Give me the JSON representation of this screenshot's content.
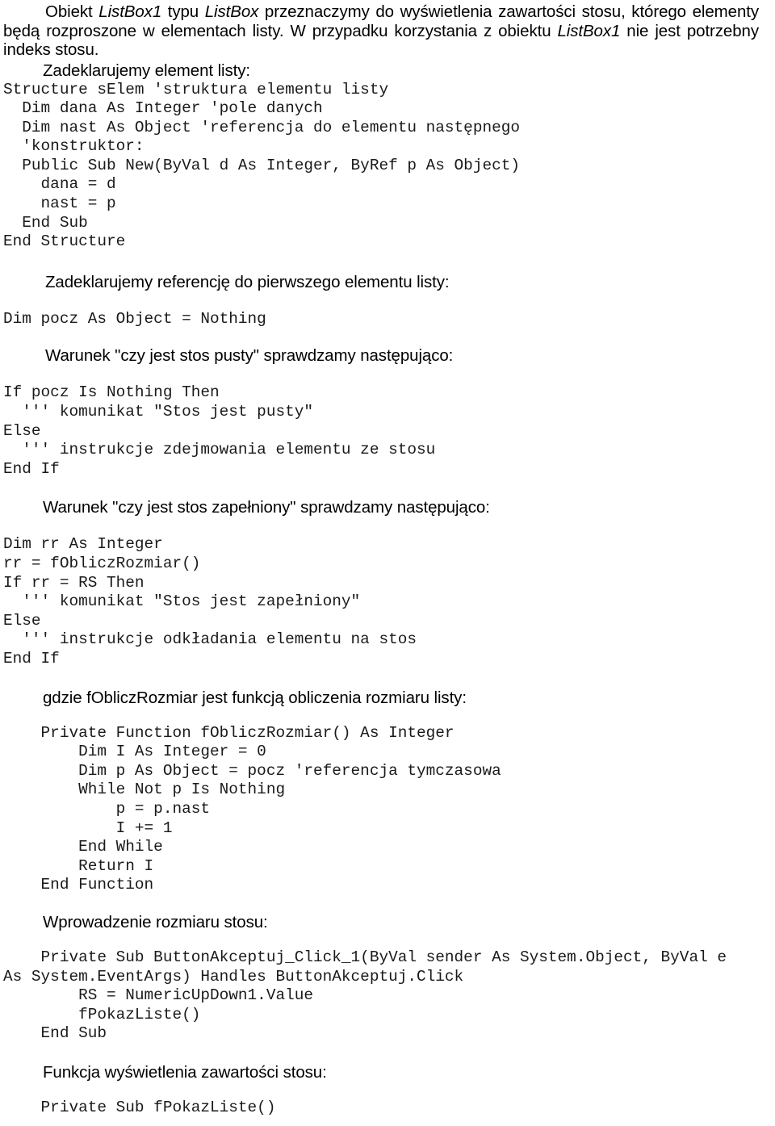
{
  "document": {
    "language": "pl",
    "intro_paragraph": {
      "segments": [
        {
          "text": "Obiekt ",
          "style": "normal"
        },
        {
          "text": "ListBox1",
          "style": "italic"
        },
        {
          "text": " typu ",
          "style": "normal"
        },
        {
          "text": "ListBox",
          "style": "italic"
        },
        {
          "text": " przeznaczymy do wyświetlenia zawartości stosu, którego elementy będą rozproszone w elementach listy. W przypadku korzystania z obiektu ",
          "style": "normal"
        },
        {
          "text": "ListBox1",
          "style": "italic"
        },
        {
          "text": " nie jest potrzebny indeks stosu.",
          "style": "normal"
        }
      ]
    },
    "sections": [
      {
        "id": "element-listy",
        "heading": "Zadeklarujemy element listy:",
        "code": "Structure sElem 'struktura elementu listy\n  Dim dana As Integer 'pole danych\n  Dim nast As Object 'referencja do elementu następnego\n  'konstruktor:\n  Public Sub New(ByVal d As Integer, ByRef p As Object)\n    dana = d\n    nast = p\n  End Sub\nEnd Structure"
      },
      {
        "id": "referencja-pierwszy",
        "heading": "Zadeklarujemy referencję do pierwszego elementu listy:",
        "code": "Dim pocz As Object = Nothing"
      },
      {
        "id": "stos-pusty",
        "heading": "Warunek \"czy jest stos pusty\" sprawdzamy następująco:",
        "code": "If pocz Is Nothing Then\n  ''' komunikat \"Stos jest pusty\"\nElse\n  ''' instrukcje zdejmowania elementu ze stosu\nEnd If"
      },
      {
        "id": "stos-zapelniony",
        "heading": "Warunek \"czy jest stos zapełniony\" sprawdzamy następująco:",
        "code": "Dim rr As Integer\nrr = fObliczRozmiar()\nIf rr = RS Then\n  ''' komunikat \"Stos jest zapełniony\"\nElse\n  ''' instrukcje odkładania elementu na stos\nEnd If"
      },
      {
        "id": "foblicz-rozmiar",
        "heading": "gdzie fObliczRozmiar jest funkcją obliczenia rozmiaru listy:",
        "code": "    Private Function fObliczRozmiar() As Integer\n        Dim I As Integer = 0\n        Dim p As Object = pocz 'referencja tymczasowa\n        While Not p Is Nothing\n            p = p.nast\n            I += 1\n        End While\n        Return I\n    End Function"
      },
      {
        "id": "wprowadzenie-rozmiaru",
        "heading": "Wprowadzenie rozmiaru stosu:",
        "code": "    Private Sub ButtonAkceptuj_Click_1(ByVal sender As System.Object, ByVal e\nAs System.EventArgs) Handles ButtonAkceptuj.Click\n        RS = NumericUpDown1.Value\n        fPokazListe()\n    End Sub"
      },
      {
        "id": "funkcja-wyswietlenia",
        "heading": "Funkcja wyświetlenia zawartości stosu:",
        "code": "    Private Sub fPokazListe()"
      }
    ]
  }
}
